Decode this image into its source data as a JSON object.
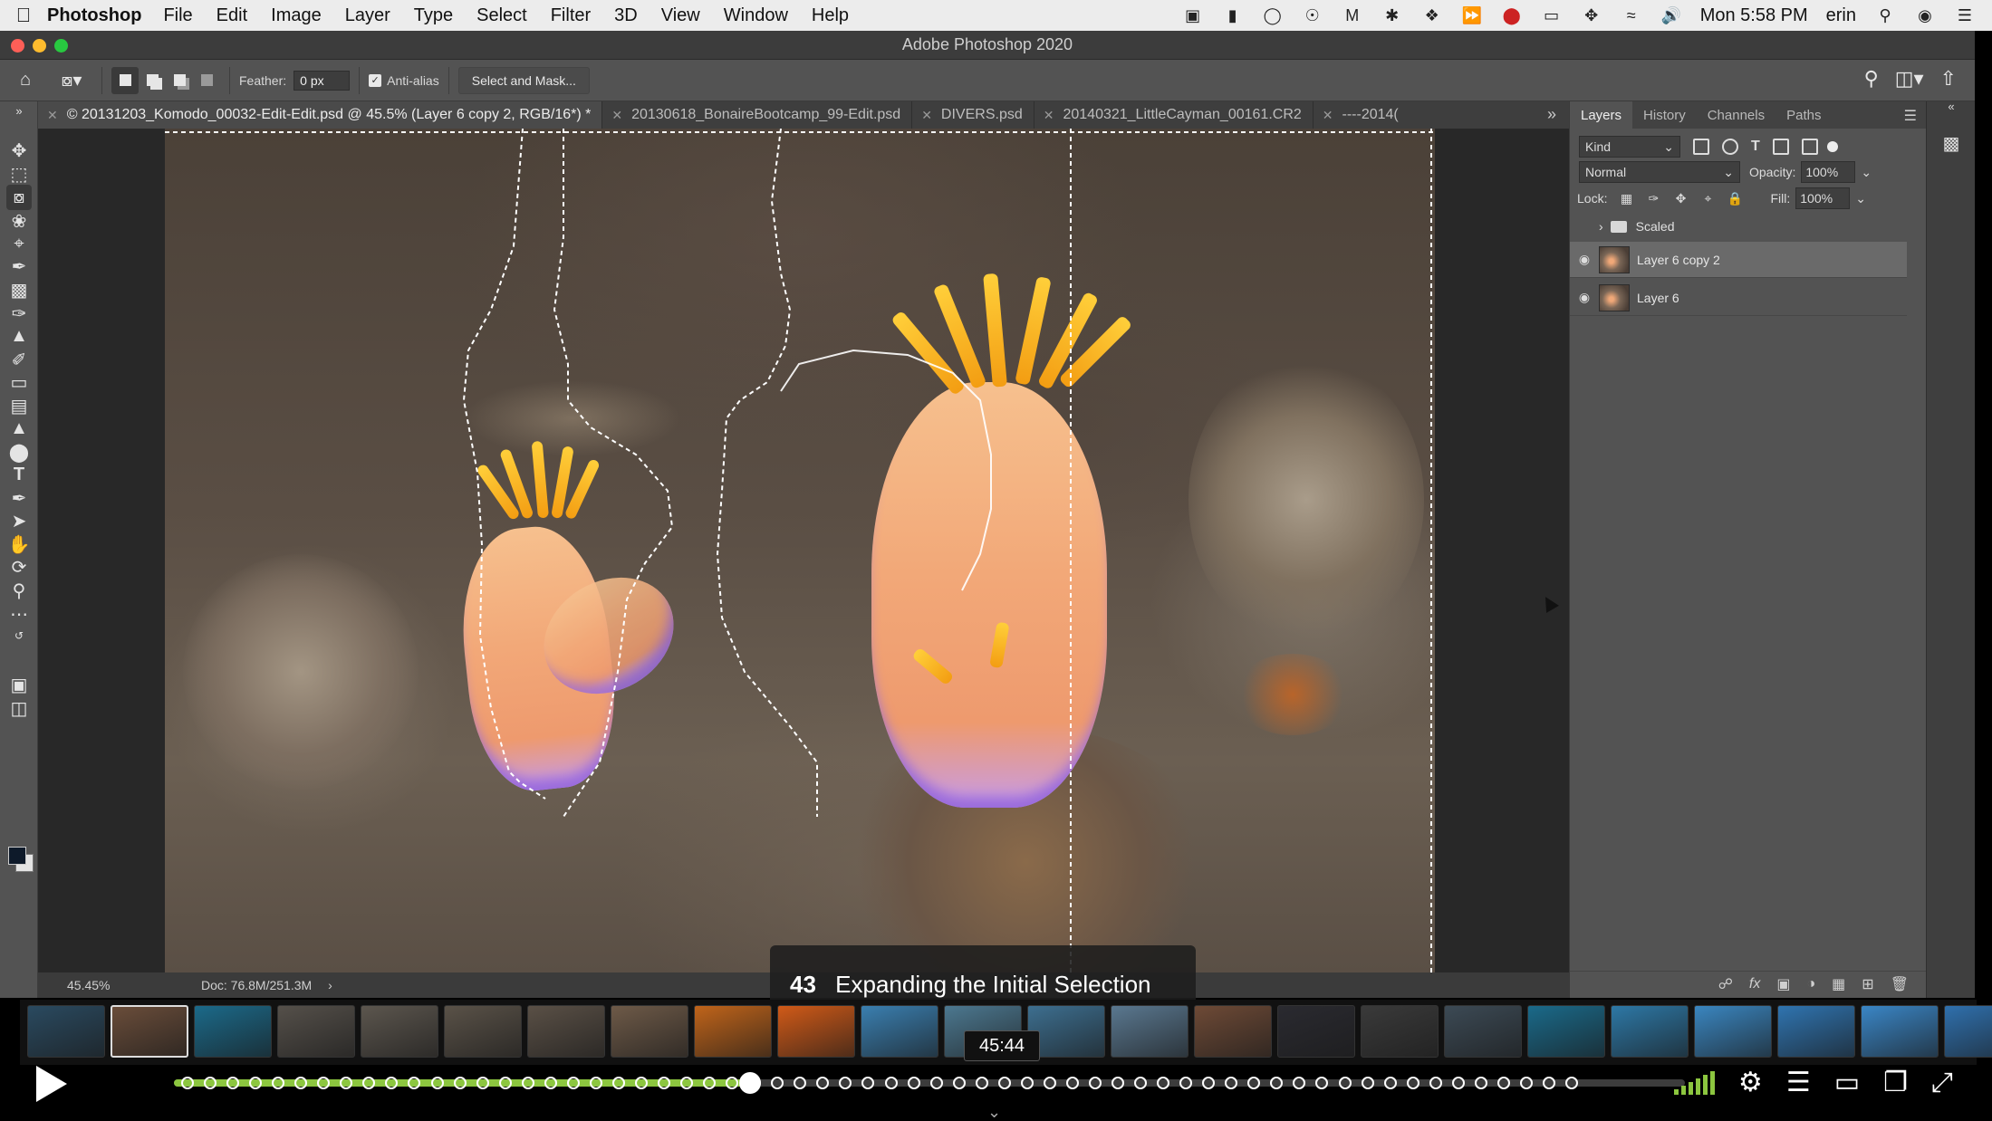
{
  "menubar": {
    "app_name": "Photoshop",
    "menus": [
      "File",
      "Edit",
      "Image",
      "Layer",
      "Type",
      "Select",
      "Filter",
      "3D",
      "View",
      "Window",
      "Help"
    ],
    "clock": "Mon 5:58 PM",
    "user": "erin"
  },
  "window": {
    "title": "Adobe Photoshop 2020"
  },
  "options_bar": {
    "feather_label": "Feather:",
    "feather_value": "0 px",
    "antialias_label": "Anti-alias",
    "antialias_checked": true,
    "select_mask_label": "Select and Mask..."
  },
  "doc_tabs": [
    {
      "label": "© 20131203_Komodo_00032-Edit-Edit.psd @ 45.5% (Layer 6 copy 2, RGB/16*) *",
      "active": true
    },
    {
      "label": "20130618_BonaireBootcamp_99-Edit.psd",
      "active": false
    },
    {
      "label": "DIVERS.psd",
      "active": false
    },
    {
      "label": "20140321_LittleCayman_00161.CR2",
      "active": false
    },
    {
      "label": "----2014(",
      "active": false
    }
  ],
  "status_bar": {
    "zoom": "45.45%",
    "doc_size": "Doc: 76.8M/251.3M"
  },
  "layers_panel": {
    "tabs": [
      "Layers",
      "History",
      "Channels",
      "Paths"
    ],
    "active_tab": "Layers",
    "filter_kind": "Kind",
    "blend_mode": "Normal",
    "opacity_label": "Opacity:",
    "opacity_value": "100%",
    "lock_label": "Lock:",
    "fill_label": "Fill:",
    "fill_value": "100%",
    "group_name": "Scaled",
    "layers": [
      {
        "name": "Layer 6 copy 2",
        "selected": true,
        "visible": true
      },
      {
        "name": "Layer 6",
        "selected": false,
        "visible": true
      }
    ]
  },
  "video": {
    "chapter_number": "43",
    "chapter_title": "Expanding the Initial Selection",
    "time": "45:44",
    "progress": 0.381
  },
  "colors": {
    "accent_green": "#8cc63f",
    "ps_panel": "#535353",
    "ps_dark": "#3b3b3b"
  }
}
